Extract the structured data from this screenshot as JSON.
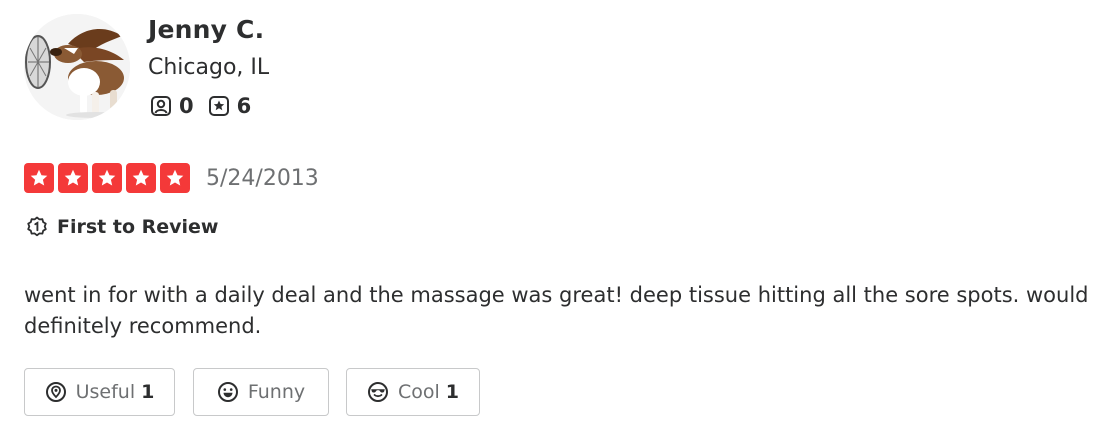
{
  "user": {
    "name": "Jenny C.",
    "location": "Chicago, IL",
    "friends_count": "0",
    "reviews_count": "6"
  },
  "review": {
    "rating": 5,
    "rating_max": 5,
    "date": "5/24/2013",
    "badge": "First to Review",
    "text": "went in for with a daily deal and the massage was great! deep tissue hitting all the sore spots. would definitely recommend."
  },
  "reactions": {
    "useful_label": "Useful",
    "useful_count": "1",
    "funny_label": "Funny",
    "cool_label": "Cool",
    "cool_count": "1"
  },
  "colors": {
    "star_red": "#f43939",
    "text_dark": "#2d2e2f",
    "text_gray": "#6e7072",
    "border_gray": "#c8c9ca"
  },
  "icons": [
    "friends-icon",
    "reviews-icon",
    "first-to-review-icon",
    "star-icon",
    "useful-icon",
    "funny-icon",
    "cool-icon"
  ]
}
